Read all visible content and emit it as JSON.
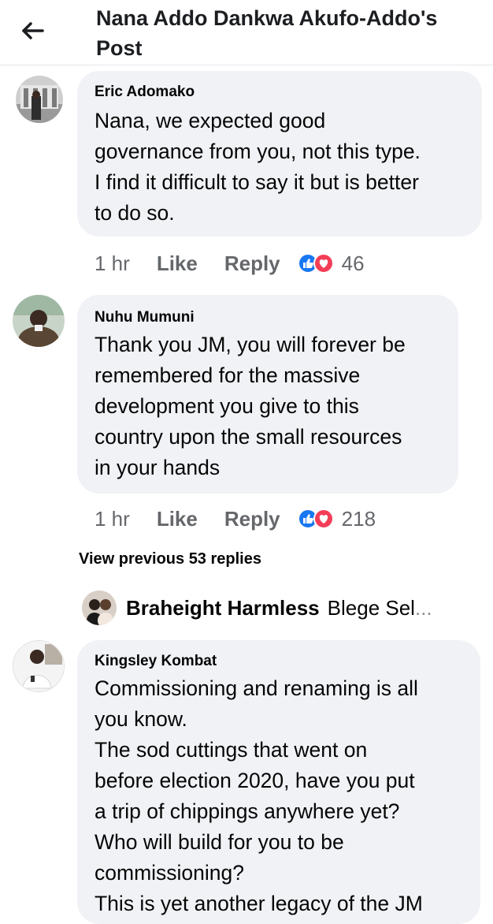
{
  "header": {
    "title": "Nana Addo Dankwa Akufo-Addo's Post"
  },
  "comments": [
    {
      "author": "Eric Adomako",
      "text": "Nana, we expected good\ngovernance from you, not this type.\nI find it difficult to say it but is better\nto do so.",
      "time": "1 hr",
      "like_label": "Like",
      "reply_label": "Reply",
      "reaction_count": "46"
    },
    {
      "author": "Nuhu Mumuni",
      "text": "Thank you JM, you will forever be\nremembered for the massive\ndevelopment you give to this\ncountry upon the small resources\nin your hands",
      "time": "1 hr",
      "like_label": "Like",
      "reply_label": "Reply",
      "reaction_count": "218"
    },
    {
      "author": "Kingsley Kombat",
      "text": "Commissioning and renaming is all\nyou know.\nThe sod cuttings that went on\nbefore election 2020, have you put\na trip of chippings anywhere yet?\nWho will build for you to be\ncommissioning?\nThis is yet another legacy of the JM"
    }
  ],
  "view_previous": "View previous 53 replies",
  "reply_preview": {
    "name": "Braheight Harmless",
    "text": "Blege Sel",
    "ellipsis": "..."
  },
  "icons": {
    "back": "back-arrow-icon",
    "like": "like-reaction-icon",
    "love": "love-reaction-icon"
  },
  "colors": {
    "bubble": "#f0f2f5",
    "like_blue": "#1877f2",
    "love_red": "#f33e58",
    "secondary_text": "#65676b"
  }
}
